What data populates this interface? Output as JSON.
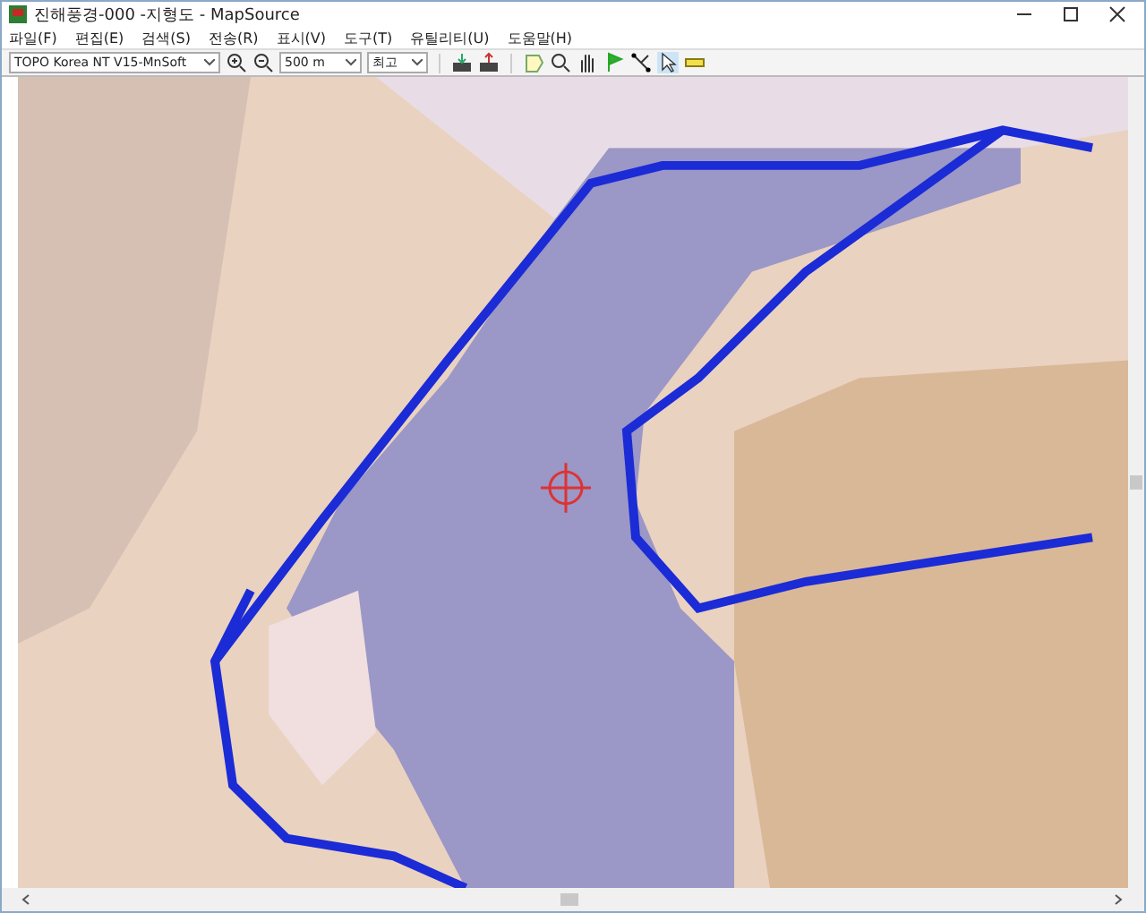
{
  "window": {
    "title": "진해풍경-000 -지형도 - MapSource"
  },
  "menu": [
    "파일(F)",
    "편집(E)",
    "검색(S)",
    "전송(R)",
    "표시(V)",
    "도구(T)",
    "유틸리티(U)",
    "도움말(H)"
  ],
  "toolbar": {
    "map_product": "TOPO Korea NT V15-MnSoft",
    "zoom_scale": "500 m",
    "detail": "최고"
  }
}
